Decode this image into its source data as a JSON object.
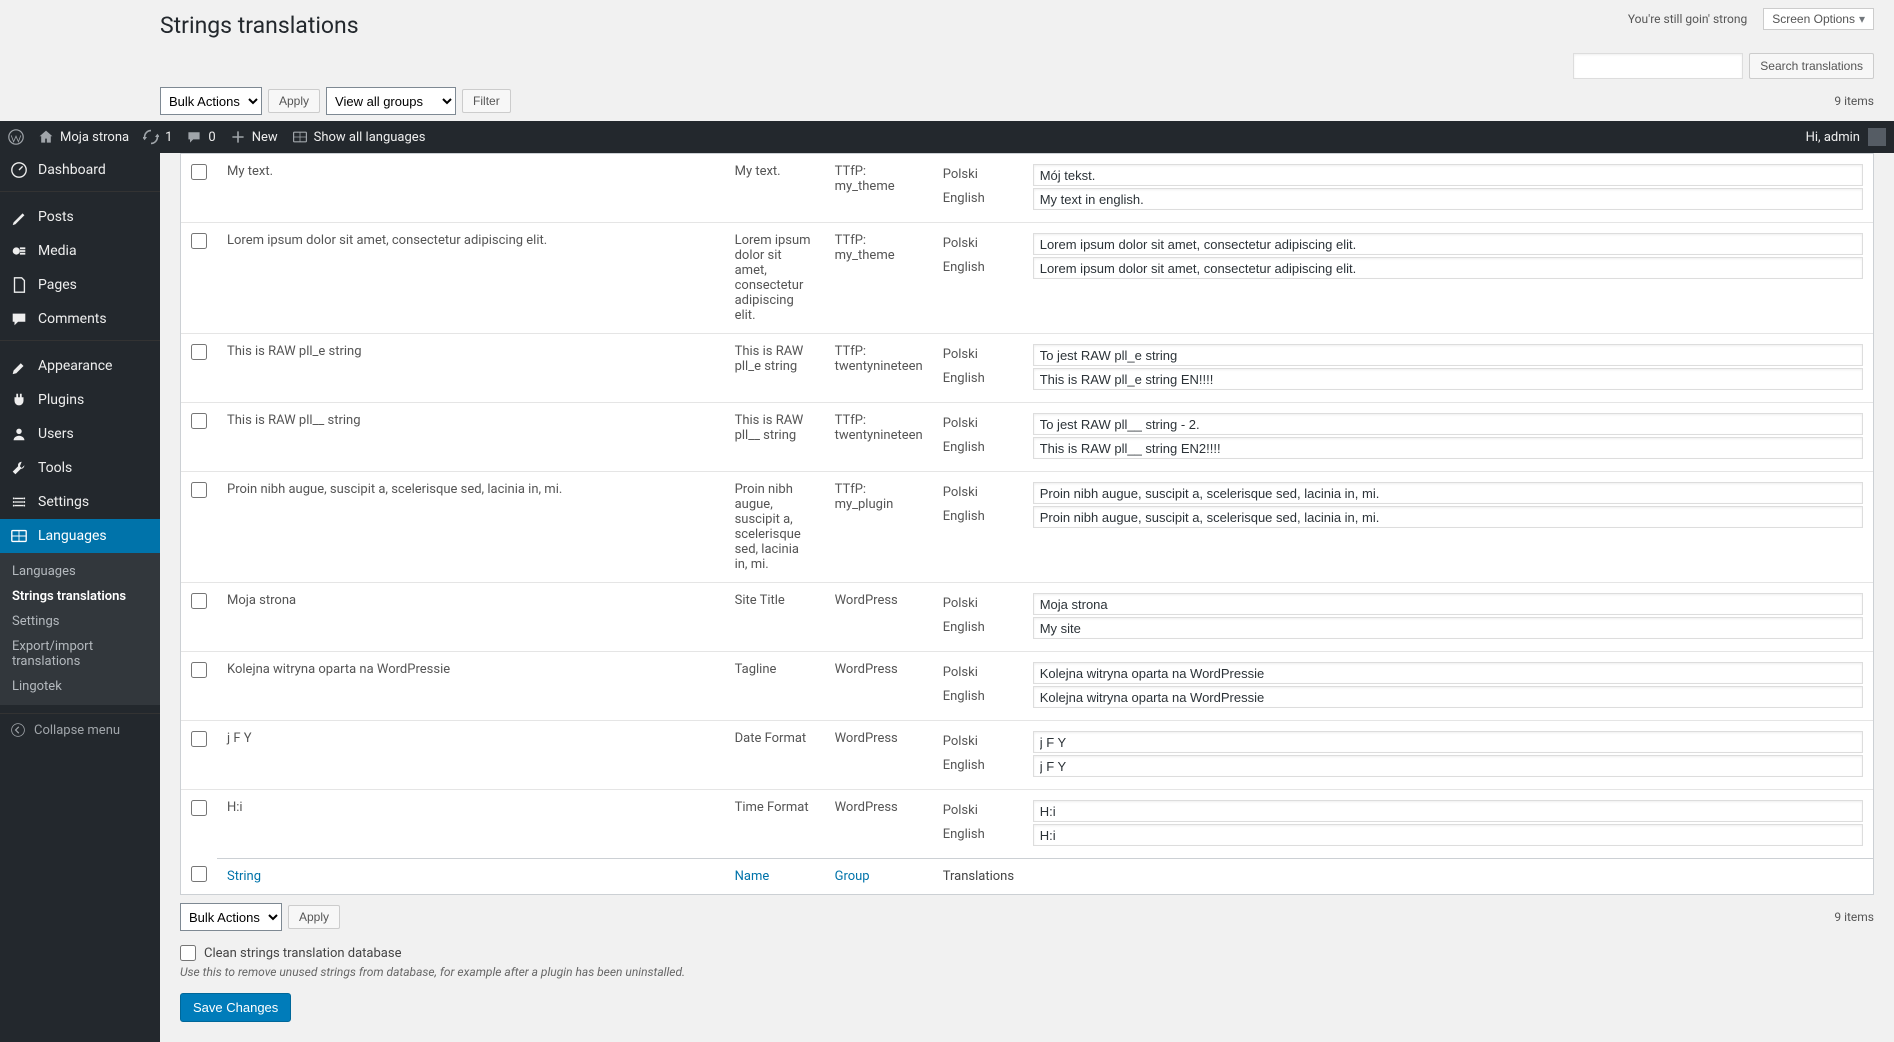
{
  "header": {
    "page_title": "Strings translations",
    "encouragement": "You're still goin' strong",
    "screen_options": "Screen Options",
    "search_btn": "Search translations",
    "bulk_actions": "Bulk Actions",
    "apply": "Apply",
    "view_all_groups": "View all groups",
    "filter": "Filter",
    "items_count": "9 items"
  },
  "adminbar": {
    "site_name": "Moja strona",
    "updates": "1",
    "comments": "0",
    "new": "New",
    "show_all_languages": "Show all languages",
    "greeting": "Hi, admin"
  },
  "sidebar": {
    "dashboard": "Dashboard",
    "posts": "Posts",
    "media": "Media",
    "pages": "Pages",
    "comments": "Comments",
    "appearance": "Appearance",
    "plugins": "Plugins",
    "users": "Users",
    "tools": "Tools",
    "settings": "Settings",
    "languages": "Languages",
    "collapse": "Collapse menu",
    "sub": {
      "languages": "Languages",
      "strings": "Strings translations",
      "settings": "Settings",
      "export": "Export/import translations",
      "lingotek": "Lingotek"
    }
  },
  "table": {
    "footer": {
      "string": "String",
      "name": "Name",
      "group": "Group",
      "translations": "Translations"
    },
    "lang1": "Polski",
    "lang2": "English",
    "rows": [
      {
        "string": "My text.",
        "name": "My text.",
        "group": "TTfP: my_theme",
        "pl": "Mój tekst.",
        "en": "My text in english."
      },
      {
        "string": "Lorem ipsum dolor sit amet, consectetur adipiscing elit.",
        "name": "Lorem ipsum dolor sit amet, consectetur adipiscing elit.",
        "group": "TTfP: my_theme",
        "pl": "Lorem ipsum dolor sit amet, consectetur adipiscing elit.",
        "en": "Lorem ipsum dolor sit amet, consectetur adipiscing elit."
      },
      {
        "string": "This is RAW pll_e string",
        "name": "This is RAW pll_e string",
        "group": "TTfP: twentynineteen",
        "pl": "To jest RAW pll_e string",
        "en": "This is RAW pll_e string EN!!!!"
      },
      {
        "string": "This is RAW pll__ string",
        "name": "This is RAW pll__ string",
        "group": "TTfP: twentynineteen",
        "pl": "To jest RAW pll__ string - 2.",
        "en": "This is RAW pll__ string EN2!!!!"
      },
      {
        "string": "Proin nibh augue, suscipit a, scelerisque sed, lacinia in, mi.",
        "name": "Proin nibh augue, suscipit a, scelerisque sed, lacinia in, mi.",
        "group": "TTfP: my_plugin",
        "pl": "Proin nibh augue, suscipit a, scelerisque sed, lacinia in, mi.",
        "en": "Proin nibh augue, suscipit a, scelerisque sed, lacinia in, mi."
      },
      {
        "string": "Moja strona",
        "name": "Site Title",
        "group": "WordPress",
        "pl": "Moja strona",
        "en": "My site"
      },
      {
        "string": "Kolejna witryna oparta na WordPressie",
        "name": "Tagline",
        "group": "WordPress",
        "pl": "Kolejna witryna oparta na WordPressie",
        "en": "Kolejna witryna oparta na WordPressie"
      },
      {
        "string": "j F Y",
        "name": "Date Format",
        "group": "WordPress",
        "pl": "j F Y",
        "en": "j F Y"
      },
      {
        "string": "H:i",
        "name": "Time Format",
        "group": "WordPress",
        "pl": "H:i",
        "en": "H:i"
      }
    ]
  },
  "bottom": {
    "bulk_actions": "Bulk Actions",
    "apply": "Apply",
    "items_count": "9 items",
    "clean_label": "Clean strings translation database",
    "clean_desc": "Use this to remove unused strings from database, for example after a plugin has been uninstalled.",
    "save": "Save Changes"
  }
}
